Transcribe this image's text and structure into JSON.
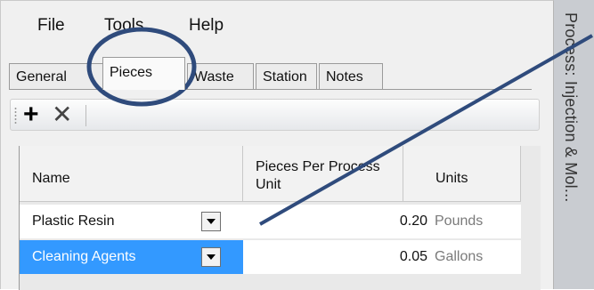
{
  "menu": {
    "items": [
      "File",
      "Tools",
      "Help"
    ]
  },
  "tabs": [
    {
      "label": "General",
      "active": false
    },
    {
      "label": "Pieces",
      "active": true
    },
    {
      "label": "Waste",
      "active": false
    },
    {
      "label": "Station",
      "active": false
    },
    {
      "label": "Notes",
      "active": false
    }
  ],
  "toolbar": {
    "add_icon": "plus-icon",
    "delete_icon": "x-icon"
  },
  "grid": {
    "columns": [
      "Name",
      "Pieces Per Process Unit",
      "Units"
    ],
    "rows": [
      {
        "name": "Plastic Resin",
        "value": "0.20",
        "unit": "Pounds",
        "selected": false
      },
      {
        "name": "Cleaning Agents",
        "value": "0.05",
        "unit": "Gallons",
        "selected": true
      }
    ]
  },
  "side_panel": {
    "title": "Process: Injection & Mol..."
  },
  "colors": {
    "selection": "#3399ff",
    "highlight_circle": "#2f4b7c",
    "unit_text": "#7a7a7a"
  }
}
